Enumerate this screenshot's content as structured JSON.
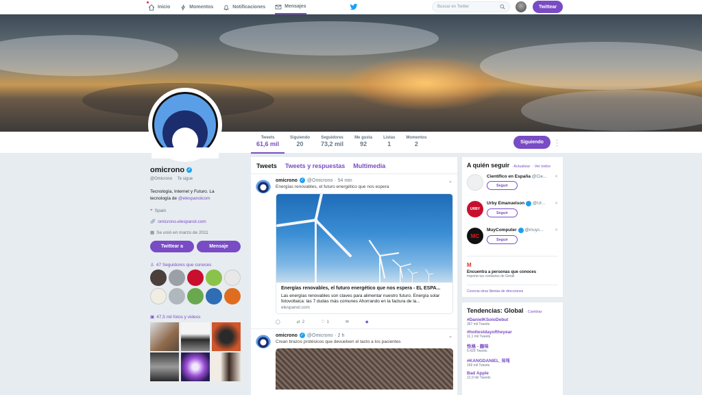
{
  "nav": {
    "home": "Inicio",
    "moments": "Momentos",
    "notifications": "Notificaciones",
    "messages": "Mensajes",
    "search_placeholder": "Buscar en Twitter",
    "tweet_button": "Twittear"
  },
  "profile": {
    "name": "omicrono",
    "handle": "@Omicrono",
    "follows_you": "Te sigue",
    "bio": "Tecnología, Internet y Futuro. La tecnología de",
    "bio_link": "@elespanolcom",
    "location": "Spain",
    "website": "omicrono.elespanol.com",
    "joined": "Se unió en marzo de 2011",
    "tweet_to_btn": "Twittear a",
    "message_btn": "Mensaje",
    "followers_you_know": "47 Seguidores que conoces",
    "photos_videos": "47,5 mil fotos y videos"
  },
  "stats": [
    {
      "label": "Tweets",
      "value": "61,6 mil"
    },
    {
      "label": "Siguiendo",
      "value": "20"
    },
    {
      "label": "Seguidores",
      "value": "73,2 mil"
    },
    {
      "label": "Me gusta",
      "value": "92"
    },
    {
      "label": "Listas",
      "value": "1"
    },
    {
      "label": "Momentos",
      "value": "2"
    }
  ],
  "following_btn": "Siguiendo",
  "tabs": {
    "tweets": "Tweets",
    "replies": "Tweets y respuestas",
    "media": "Multimedia"
  },
  "tweets": [
    {
      "name": "omicrono",
      "handle": "@Omicrono",
      "time": "· 54 min",
      "text": "Energías renovables, el futuro energético que nos espera",
      "card_title": "Energías renovables, el futuro energético que nos espera - EL ESPA...",
      "card_desc": "Las energías renovables son claves para alimentar nuestro futuro. Energía solar fotovoltaica: las 7 dudas más comunes Ahorrando en la factura de la...",
      "card_domain": "elespanol.com",
      "retweets": "2",
      "likes": "1"
    },
    {
      "name": "omicrono",
      "handle": "@Omicrono",
      "time": "· 2 h",
      "text": "Crean brazos protésicos que devuelven el tacto a los pacientes"
    }
  ],
  "who_to_follow": {
    "title": "A quién seguir",
    "refresh": "· Actualizar",
    "view_all": "· Ver todos",
    "users": [
      {
        "name": "Científico en España",
        "handle": "@Cie...",
        "btn": "Seguir"
      },
      {
        "name": "Urby Emanuelson",
        "handle": "@Ur...",
        "btn": "Seguir"
      },
      {
        "name": "MuyComputer",
        "handle": "@muyc...",
        "btn": "Seguir"
      }
    ],
    "find_title": "Encuentra a personas que conoces",
    "find_sub": "Importa tus contactos de Gmail",
    "connect": "Conecta otras libretas de direcciones"
  },
  "trends": {
    "title": "Tendencias: Global",
    "change": "· Cambiar",
    "items": [
      {
        "tag": "#DanielKSoloDebut",
        "count": "367 mil Tweets"
      },
      {
        "tag": "#hottestdayoftheyear",
        "count": "11,1 mil Tweets"
      },
      {
        "tag": "性格 - 趣味",
        "count": "5.429 Tweets"
      },
      {
        "tag": "#KANGDANIEL_뭐해",
        "count": "169 mil Tweets"
      },
      {
        "tag": "Bad Apple",
        "count": "12,9 mil Tweets"
      }
    ]
  },
  "colors": {
    "accent": "#794bc4",
    "verified": "#1da1f2",
    "background": "#e6ecf0"
  }
}
